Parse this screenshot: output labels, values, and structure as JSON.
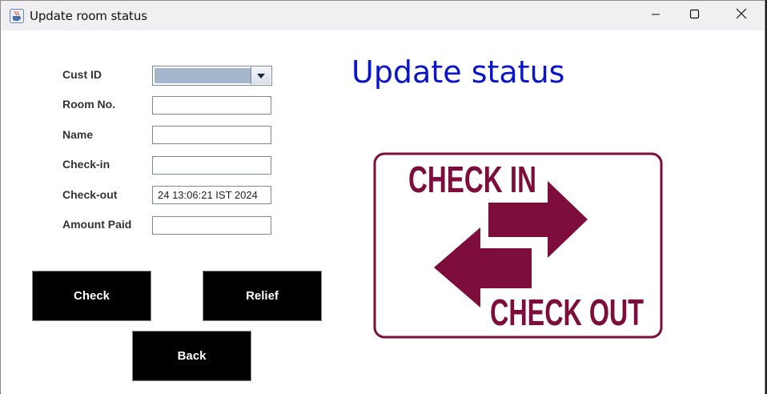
{
  "window": {
    "title": "Update room status"
  },
  "form": {
    "heading": "Update status",
    "fields": {
      "cust_id": {
        "label": "Cust ID",
        "value": ""
      },
      "room_no": {
        "label": "Room No.",
        "value": ""
      },
      "name": {
        "label": "Name",
        "value": ""
      },
      "check_in": {
        "label": "Check-in",
        "value": ""
      },
      "check_out": {
        "label": "Check-out",
        "value": "24 13:06:21 IST 2024"
      },
      "amount_paid": {
        "label": "Amount Paid",
        "value": ""
      }
    }
  },
  "buttons": {
    "check": "Check",
    "relief": "Relief",
    "back": "Back"
  },
  "sign": {
    "top_text": "CHECK IN",
    "bottom_text": "CHECK OUT"
  },
  "colors": {
    "heading": "#0a14c8",
    "sign_maroon": "#7d0e3c",
    "button_bg": "#000000",
    "combo_selection": "#a3b6cc"
  },
  "icons": {
    "app": "java-cup-icon",
    "minimize": "minimize-icon",
    "maximize": "maximize-icon",
    "close": "close-icon",
    "combo_arrow": "chevron-down-icon"
  }
}
